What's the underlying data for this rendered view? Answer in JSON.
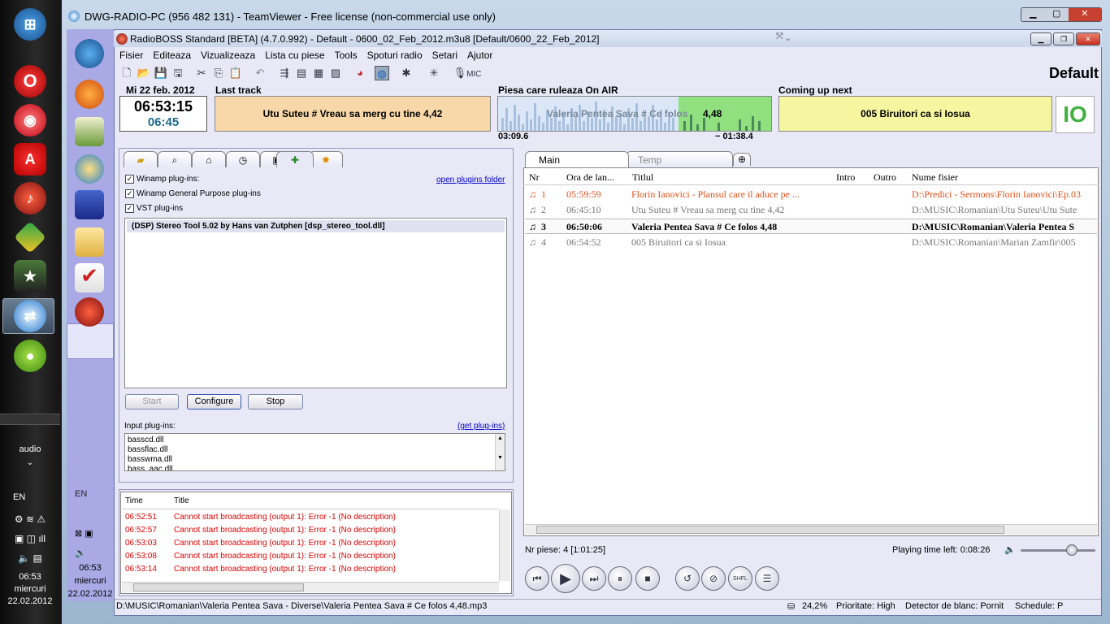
{
  "os_taskbar": {
    "language": "audio",
    "lang_code": "EN",
    "clock": {
      "time": "06:53",
      "day": "miercuri",
      "date": "22.02.2012"
    }
  },
  "teamviewer": {
    "title": "DWG-RADIO-PC (956 482 131) - TeamViewer - Free license (non-commercial use only)",
    "sidebar_lang": "EN",
    "sidebar_clock": {
      "time": "06:53",
      "day": "miercuri",
      "date": "22.02.2012"
    }
  },
  "app": {
    "title": "RadioBOSS Standard [BETA] (4.7.0.992) - Default - 0600_02_Feb_2012.m3u8 [Default/0600_22_Feb_2012]",
    "profile": "Default"
  },
  "menu": [
    "Fisier",
    "Editeaza",
    "Vizualizeaza",
    "Lista cu piese",
    "Tools",
    "Spoturi radio",
    "Setari",
    "Ajutor"
  ],
  "toolbar": {
    "mic_label": "MIC"
  },
  "header": {
    "date": "Mi 22 feb. 2012",
    "clock": "06:53:15",
    "clock_sub": "06:45",
    "last_track_label": "Last track",
    "last_track": "Utu Suteu # Vreau sa merg cu tine 4,42",
    "on_air_label": "Piesa care ruleaza On AIR",
    "on_air_track": "Valeria Pentea Sava # Ce folos",
    "on_air_dur": "4,48",
    "elapsed": "03:09.6",
    "remaining": "− 01:38.4",
    "next_label": "Coming up next",
    "next_track": "005 Biruitori ca si Iosua",
    "logo_text": "IO"
  },
  "plugins": {
    "winamp_label": "Winamp plug-ins:",
    "winamp_gp_label": "Winamp General Purpose plug-ins",
    "vst_label": "VST plug-ins",
    "open_folder": "open plugins folder",
    "selected_plugin": "(DSP) Stereo Tool 5.02 by Hans van Zutphen [dsp_stereo_tool.dll]",
    "start": "Start",
    "configure": "Configure",
    "stop": "Stop",
    "input_label": "Input plug-ins:",
    "get_plugins": "(get plug-ins)",
    "input_list": [
      "basscd.dll",
      "bassflac.dll",
      "basswma.dll",
      "bass_aac.dll"
    ]
  },
  "log": {
    "col_time": "Time",
    "col_title": "Title",
    "rows": [
      {
        "time": "06:52:51",
        "title": "Cannot start broadcasting (output 1): Error -1 (No description)"
      },
      {
        "time": "06:52:57",
        "title": "Cannot start broadcasting (output 1): Error -1 (No description)"
      },
      {
        "time": "06:53:03",
        "title": "Cannot start broadcasting (output 1): Error -1 (No description)"
      },
      {
        "time": "06:53:08",
        "title": "Cannot start broadcasting (output 1): Error -1 (No description)"
      },
      {
        "time": "06:53:14",
        "title": "Cannot start broadcasting (output 1): Error -1 (No description)"
      }
    ]
  },
  "playlist": {
    "tabs": [
      "Main",
      "Temp"
    ],
    "columns": [
      "Nr",
      "Ora de lan...",
      "Titlul",
      "Intro",
      "Outro",
      "Nume fisier"
    ],
    "rows": [
      {
        "nr": "1",
        "time": "05:59:59",
        "title": "Florin Ianovici - Plansul care il aduce pe ...",
        "file": "D:\\Predici - Sermons\\Florin Ianovici\\Ep.03",
        "color": "#e0501a",
        "bold": false
      },
      {
        "nr": "2",
        "time": "06:45:10",
        "title": "Utu Suteu # Vreau sa merg cu tine 4,42",
        "file": "D:\\MUSIC\\Romanian\\Utu Suteu\\Utu Sute",
        "color": "#777777",
        "bold": false
      },
      {
        "nr": "3",
        "time": "06:50:06",
        "title": "Valeria Pentea Sava # Ce folos     4,48",
        "file": "D:\\MUSIC\\Romanian\\Valeria Pentea S",
        "color": "#000000",
        "bold": true
      },
      {
        "nr": "4",
        "time": "06:54:52",
        "title": "005 Biruitori ca si Iosua",
        "file": "D:\\MUSIC\\Romanian\\Marian Zamfir\\005",
        "color": "#777777",
        "bold": false
      }
    ],
    "summary": "Nr piese: 4 [1:01:25]",
    "time_left": "Playing time left: 0:08:26",
    "volume": 0.68
  },
  "status": {
    "path": "D:\\MUSIC\\Romanian\\Valeria Pentea Sava - Diverse\\Valeria Pentea Sava # Ce folos     4,48.mp3",
    "cpu": "24,2%",
    "priority": "Prioritate: High",
    "detector": "Detector de blanc: Pornit",
    "schedule": "Schedule: P"
  }
}
